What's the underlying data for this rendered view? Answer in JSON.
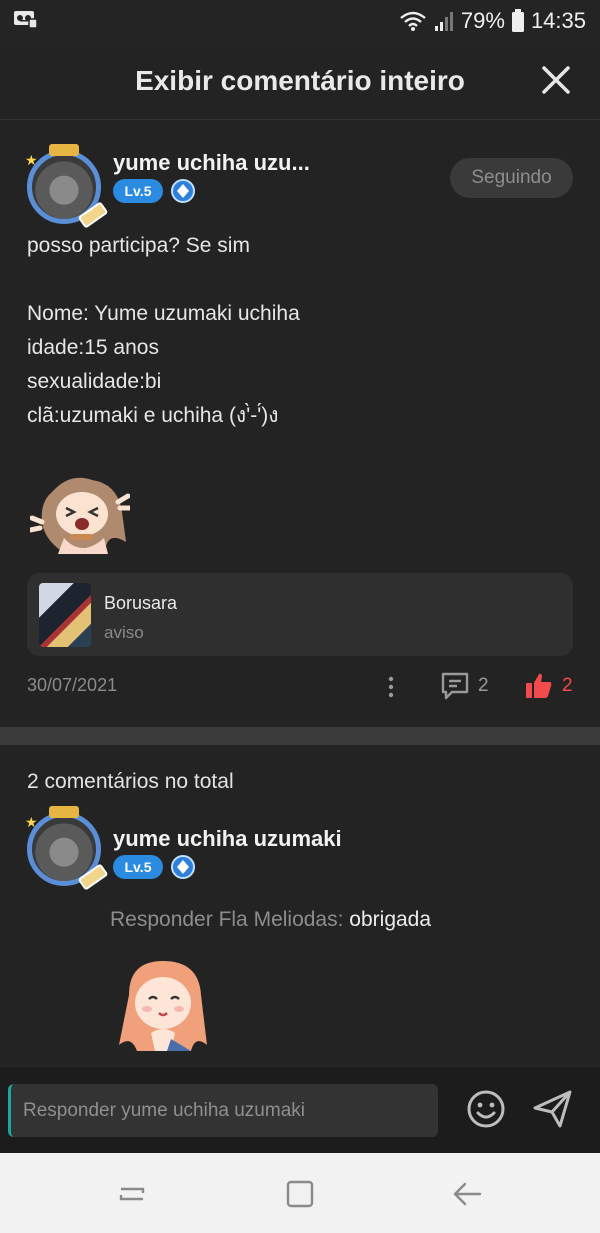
{
  "status": {
    "battery": "79%",
    "time": "14:35"
  },
  "header": {
    "title": "Exibir comentário inteiro"
  },
  "post": {
    "author": "yume uchiha uzu...",
    "level": "Lv.5",
    "follow_label": "Seguindo",
    "text": "posso participa? Se sim\n\nNome:  Yume uzumaki uchiha\nidade:15 anos\nsexualidade:bi\nclã:uzumaki e uchiha (ง'̀-'́)ง",
    "link_card": {
      "title": "Borusara",
      "subtitle": "aviso"
    },
    "date": "30/07/2021",
    "comment_count": "2",
    "like_count": "2"
  },
  "comments": {
    "total_label": "2 comentários no total",
    "items": [
      {
        "author": "yume uchiha uzumaki",
        "level": "Lv.5",
        "reply_prefix": "Responder Fla Meliodas:",
        "reply_text": "obrigada"
      }
    ]
  },
  "composer": {
    "placeholder": "Responder yume uchiha uzumaki"
  },
  "colors": {
    "background": "#232323",
    "level_badge": "#2a8be0",
    "like": "#f24b4b"
  },
  "icons": [
    "voicemail-icon",
    "wifi-icon",
    "signal-icon",
    "battery-icon",
    "close-icon",
    "more-vertical-icon",
    "comment-icon",
    "like-icon",
    "emoji-icon",
    "send-icon",
    "recent-apps-icon",
    "home-icon",
    "back-icon"
  ]
}
